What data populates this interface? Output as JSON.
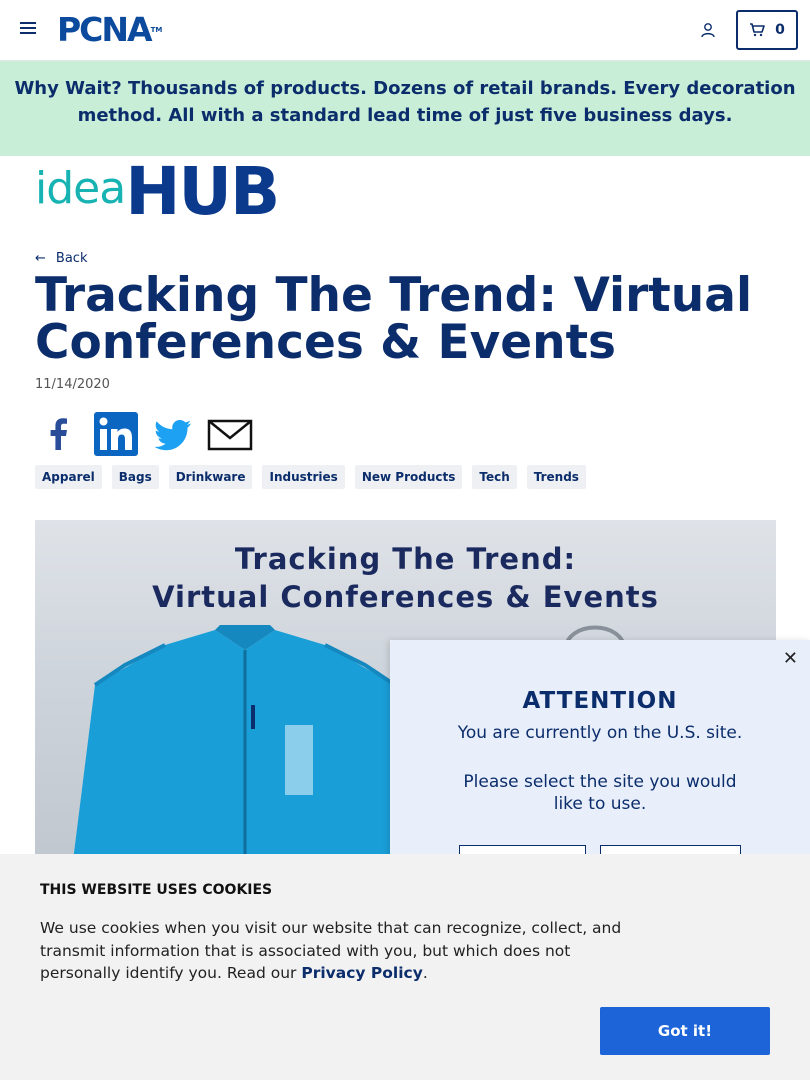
{
  "header": {
    "logo_text": "PCNA",
    "logo_tm": "TM",
    "cart_count": "0"
  },
  "banner": {
    "lead": "Why Wait?",
    "text": "Thousands of products. Dozens of retail brands. Every decoration method. All with a standard lead time of just five business days."
  },
  "hub": {
    "idea": "idea",
    "hub": "HUB"
  },
  "article": {
    "back_label": "Back",
    "title": "Tracking The Trend: Virtual Conferences & Events",
    "date": "11/14/2020",
    "tags": [
      "Apparel",
      "Bags",
      "Drinkware",
      "Industries",
      "New Products",
      "Tech",
      "Trends"
    ],
    "hero_title_line1": "Tracking The Trend:",
    "hero_title_line2": "Virtual Conferences & Events"
  },
  "share": {
    "icons": [
      "facebook-icon",
      "linkedin-icon",
      "twitter-icon",
      "email-icon"
    ]
  },
  "modal": {
    "heading": "ATTENTION",
    "line1": "You are currently on the U.S. site.",
    "line2": "Please select the site you would like to use."
  },
  "cookie": {
    "title": "THIS WEBSITE USES COOKIES",
    "text": "We use cookies when you visit our website that can recognize, collect, and transmit information that is associated with you, but which does not personally identify you. Read our ",
    "link": "Privacy Policy",
    "period": ".",
    "button": "Got it!"
  },
  "colors": {
    "navy": "#0b2d6b",
    "brand_blue": "#0b4a9c",
    "teal": "#17b3b3",
    "banner_bg": "#c9eed8",
    "button_blue": "#1e64d9"
  }
}
